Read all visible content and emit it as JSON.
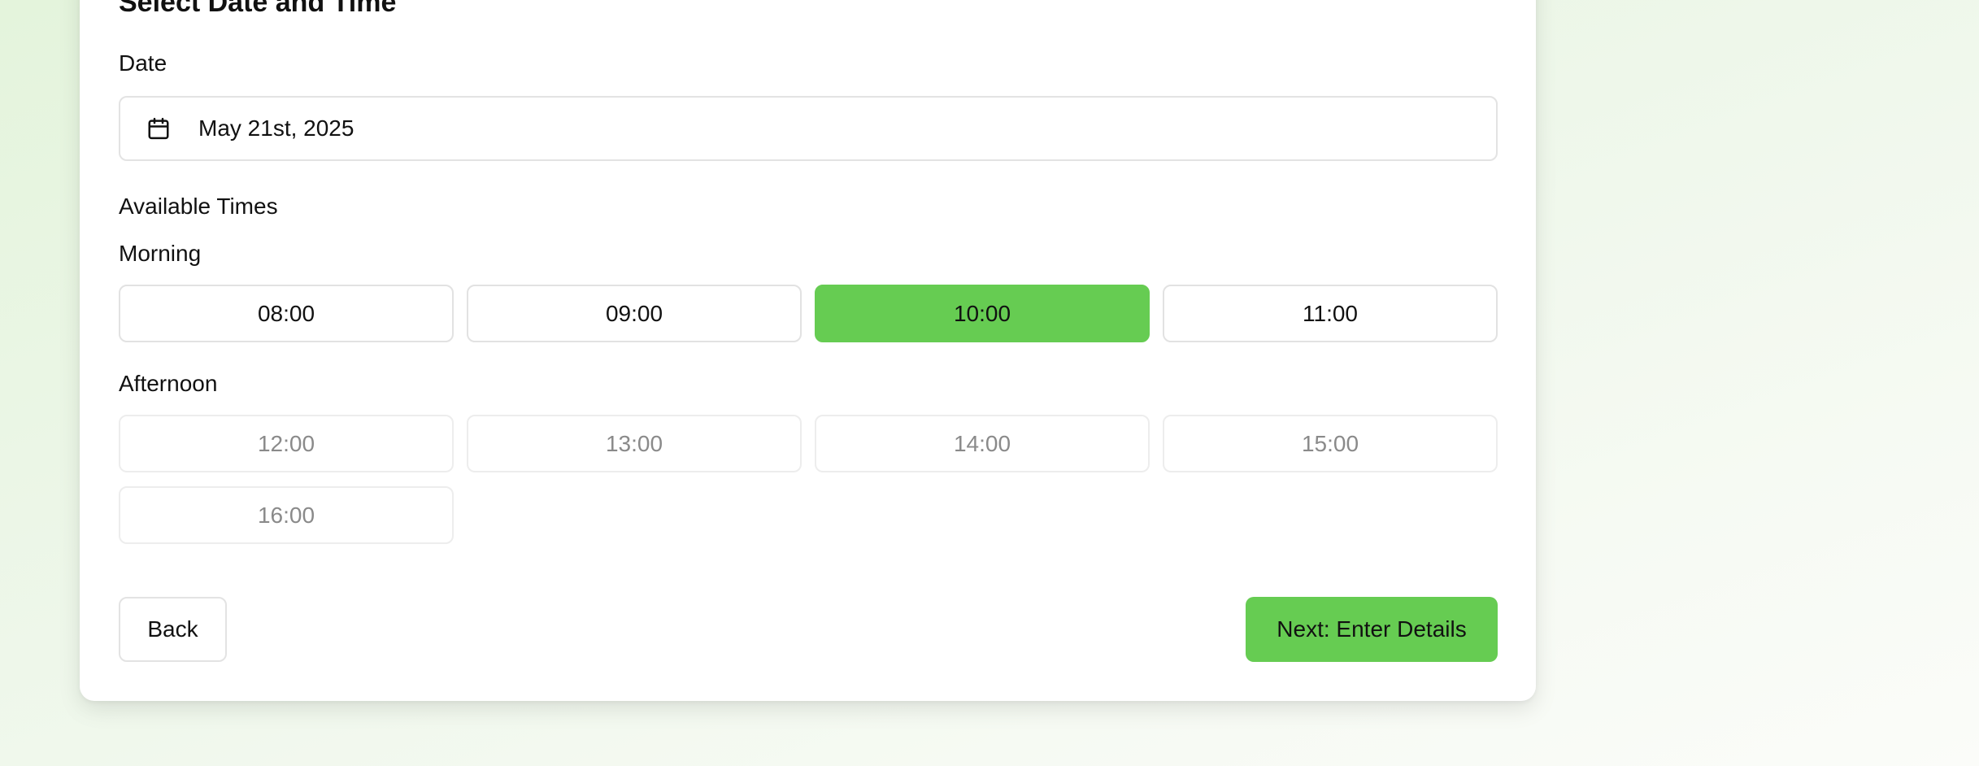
{
  "form": {
    "title": "Select Date and Time",
    "date_label": "Date",
    "date_value": "May 21st, 2025",
    "available_times_label": "Available Times"
  },
  "morning": {
    "label": "Morning",
    "slots": [
      {
        "time": "08:00",
        "state": "available"
      },
      {
        "time": "09:00",
        "state": "available"
      },
      {
        "time": "10:00",
        "state": "selected"
      },
      {
        "time": "11:00",
        "state": "available"
      }
    ]
  },
  "afternoon": {
    "label": "Afternoon",
    "slots": [
      {
        "time": "12:00",
        "state": "disabled"
      },
      {
        "time": "13:00",
        "state": "disabled"
      },
      {
        "time": "14:00",
        "state": "disabled"
      },
      {
        "time": "15:00",
        "state": "disabled"
      },
      {
        "time": "16:00",
        "state": "disabled"
      }
    ]
  },
  "actions": {
    "back_label": "Back",
    "next_label": "Next: Enter Details"
  },
  "icons": {
    "date": "calendar-icon"
  },
  "colors": {
    "accent": "#66cc52",
    "disabled_text": "#8a8a8a",
    "border": "#e3e3e3"
  }
}
